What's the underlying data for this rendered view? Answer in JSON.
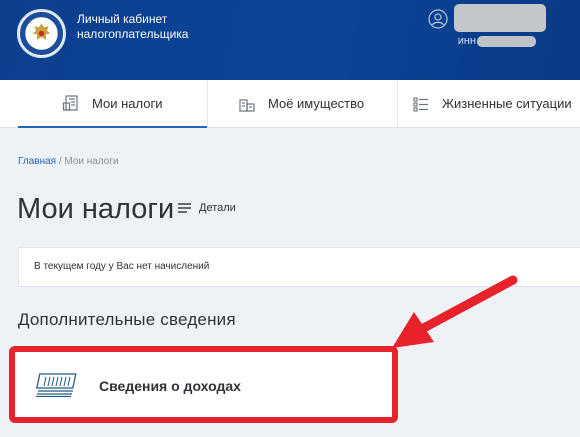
{
  "header": {
    "brand_line1": "Личный кабинет",
    "brand_line2": "налогоплательщика",
    "inn_label": "ИНН"
  },
  "tabs": [
    {
      "label": "Мои налоги",
      "icon": "tax-document-icon",
      "active": true
    },
    {
      "label": "Моё имущество",
      "icon": "property-icon",
      "active": false
    },
    {
      "label": "Жизненные ситуации",
      "icon": "list-icon",
      "active": false
    }
  ],
  "breadcrumb": {
    "home": "Главная",
    "separator": " / ",
    "current": "Мои налоги"
  },
  "page": {
    "title": "Мои налоги",
    "details_label": "Детали",
    "info_message": "В текущем году у Вас нет начислений",
    "section_title": "Дополнительные сведения",
    "income_card_label": "Сведения о доходах"
  },
  "colors": {
    "header_bg": "#0b4497",
    "accent": "#2466bf",
    "highlight_red": "#e8222a",
    "page_bg": "#eef1f5"
  }
}
